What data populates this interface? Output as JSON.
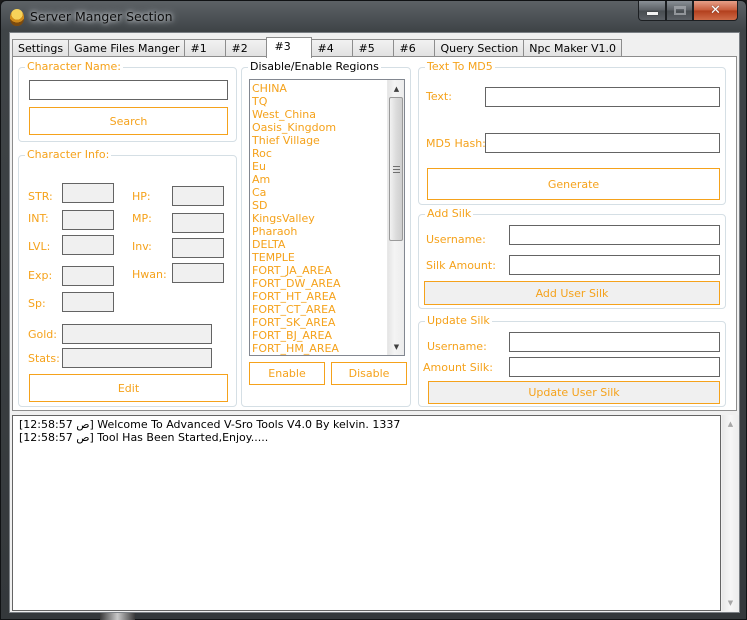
{
  "window": {
    "title": "Server Manger Section",
    "caption_buttons": [
      "minimize",
      "maximize",
      "close"
    ]
  },
  "tabs": [
    {
      "label": "Settings",
      "active": false
    },
    {
      "label": "Game Files Manger",
      "active": false
    },
    {
      "label": "#1",
      "active": false
    },
    {
      "label": "#2",
      "active": false
    },
    {
      "label": "#3",
      "active": true
    },
    {
      "label": "#4",
      "active": false
    },
    {
      "label": "#5",
      "active": false
    },
    {
      "label": "#6",
      "active": false
    },
    {
      "label": "Query Section",
      "active": false
    },
    {
      "label": "Npc Maker V1.0",
      "active": false
    }
  ],
  "character_name": {
    "legend": "Character Name:",
    "input_value": "",
    "search_label": "Search"
  },
  "character_info": {
    "legend": "Character Info:",
    "fields": {
      "str": {
        "label": "STR:",
        "value": ""
      },
      "int": {
        "label": "INT:",
        "value": ""
      },
      "lvl": {
        "label": "LVL:",
        "value": ""
      },
      "exp": {
        "label": "Exp:",
        "value": ""
      },
      "sp": {
        "label": "Sp:",
        "value": ""
      },
      "hp": {
        "label": "HP:",
        "value": ""
      },
      "mp": {
        "label": "MP:",
        "value": ""
      },
      "inv": {
        "label": "Inv:",
        "value": ""
      },
      "hwan": {
        "label": "Hwan:",
        "value": ""
      },
      "gold": {
        "label": "Gold:",
        "value": ""
      },
      "stats": {
        "label": "Stats:",
        "value": ""
      }
    },
    "edit_label": "Edit"
  },
  "regions": {
    "legend": "Disable/Enable Regions",
    "items": [
      "CHINA",
      "TQ",
      "West_China",
      "Oasis_Kingdom",
      "Thief Village",
      "Roc",
      "Eu",
      "Am",
      "Ca",
      "SD",
      "KingsValley",
      "Pharaoh",
      "DELTA",
      "TEMPLE",
      "FORT_JA_AREA",
      "FORT_DW_AREA",
      "FORT_HT_AREA",
      "FORT_CT_AREA",
      "FORT_SK_AREA",
      "FORT_BJ_AREA",
      "FORT_HM_AREA"
    ],
    "enable_label": "Enable",
    "disable_label": "Disable"
  },
  "md5": {
    "legend": "Text To MD5",
    "text_label": "Text:",
    "text_value": "",
    "hash_label": "MD5 Hash:",
    "hash_value": "",
    "generate_label": "Generate"
  },
  "add_silk": {
    "legend": "Add Silk",
    "username_label": "Username:",
    "username_value": "",
    "amount_label": "Silk Amount:",
    "amount_value": "",
    "button_label": "Add User Silk"
  },
  "update_silk": {
    "legend": "Update Silk",
    "username_label": "Username:",
    "username_value": "",
    "amount_label": "Amount Silk:",
    "amount_value": "",
    "button_label": "Update User Silk"
  },
  "log": {
    "lines": [
      "[12:58:57 ص] Welcome To Advanced V-Sro Tools V4.0 By kelvin. 1337",
      "[12:58:57 ص] Tool Has Been Started,Enjoy....."
    ]
  },
  "colors": {
    "accent": "#f5a21b",
    "window_frame": "#3f4447",
    "close_button": "#c65a3a"
  }
}
